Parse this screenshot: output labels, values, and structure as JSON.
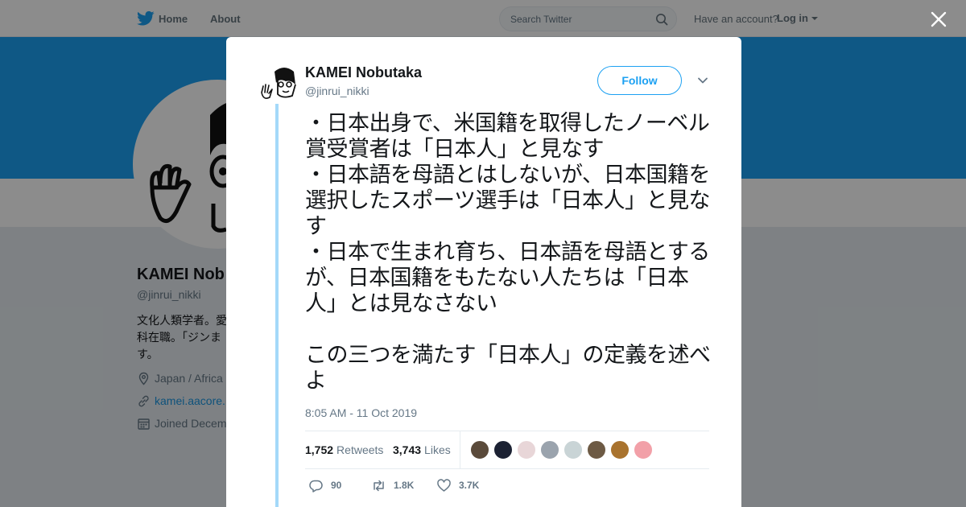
{
  "topnav": {
    "home_label": "Home",
    "about_label": "About",
    "search_placeholder": "Search Twitter",
    "have_account_text": "Have an account?",
    "login_label": "Log in"
  },
  "profile": {
    "name": "KAMEI Nob",
    "handle": "@jinrui_nikki",
    "bio": "文化人類学者。愛学科在職。「ジンます。",
    "location": "Japan / Africa",
    "url": "kamei.aacore.",
    "joined": "Joined Decem"
  },
  "tweet": {
    "author_name": "KAMEI Nobutaka",
    "author_handle": "@jinrui_nikki",
    "follow_label": "Follow",
    "text": "・日本出身で、米国籍を取得したノーベル賞受賞者は「日本人」と見なす\n・日本語を母語とはしないが、日本国籍を選択したスポーツ選手は「日本人」と見なす\n・日本で生まれ育ち、日本語を母語とするが、日本国籍をもたない人たちは「日本人」とは見なさない\n\nこの三つを満たす「日本人」の定義を述べよ",
    "timestamp": "8:05 AM - 11 Oct 2019",
    "retweets_count": "1,752",
    "retweets_label": "Retweets",
    "likes_count": "3,743",
    "likes_label": "Likes",
    "reply_count": "90",
    "retweet_action_count": "1.8K",
    "like_action_count": "3.7K"
  },
  "likers": [
    {
      "color": "#5a4a3a"
    },
    {
      "color": "#1c2233"
    },
    {
      "color": "#e8d6d8"
    },
    {
      "color": "#9aa3ad"
    },
    {
      "color": "#c9d4d6"
    },
    {
      "color": "#6d5a44"
    },
    {
      "color": "#a9732e"
    },
    {
      "color": "#f2a0a8"
    }
  ],
  "colors": {
    "brand_blue": "#1da1f2",
    "banner": "#1da1f2",
    "thread_line": "#a4d9f9"
  },
  "icons": [
    "twitter-bird-icon",
    "search-icon",
    "close-icon",
    "chevron-down-icon",
    "reply-icon",
    "retweet-icon",
    "heart-icon",
    "location-icon",
    "link-icon",
    "calendar-icon"
  ]
}
